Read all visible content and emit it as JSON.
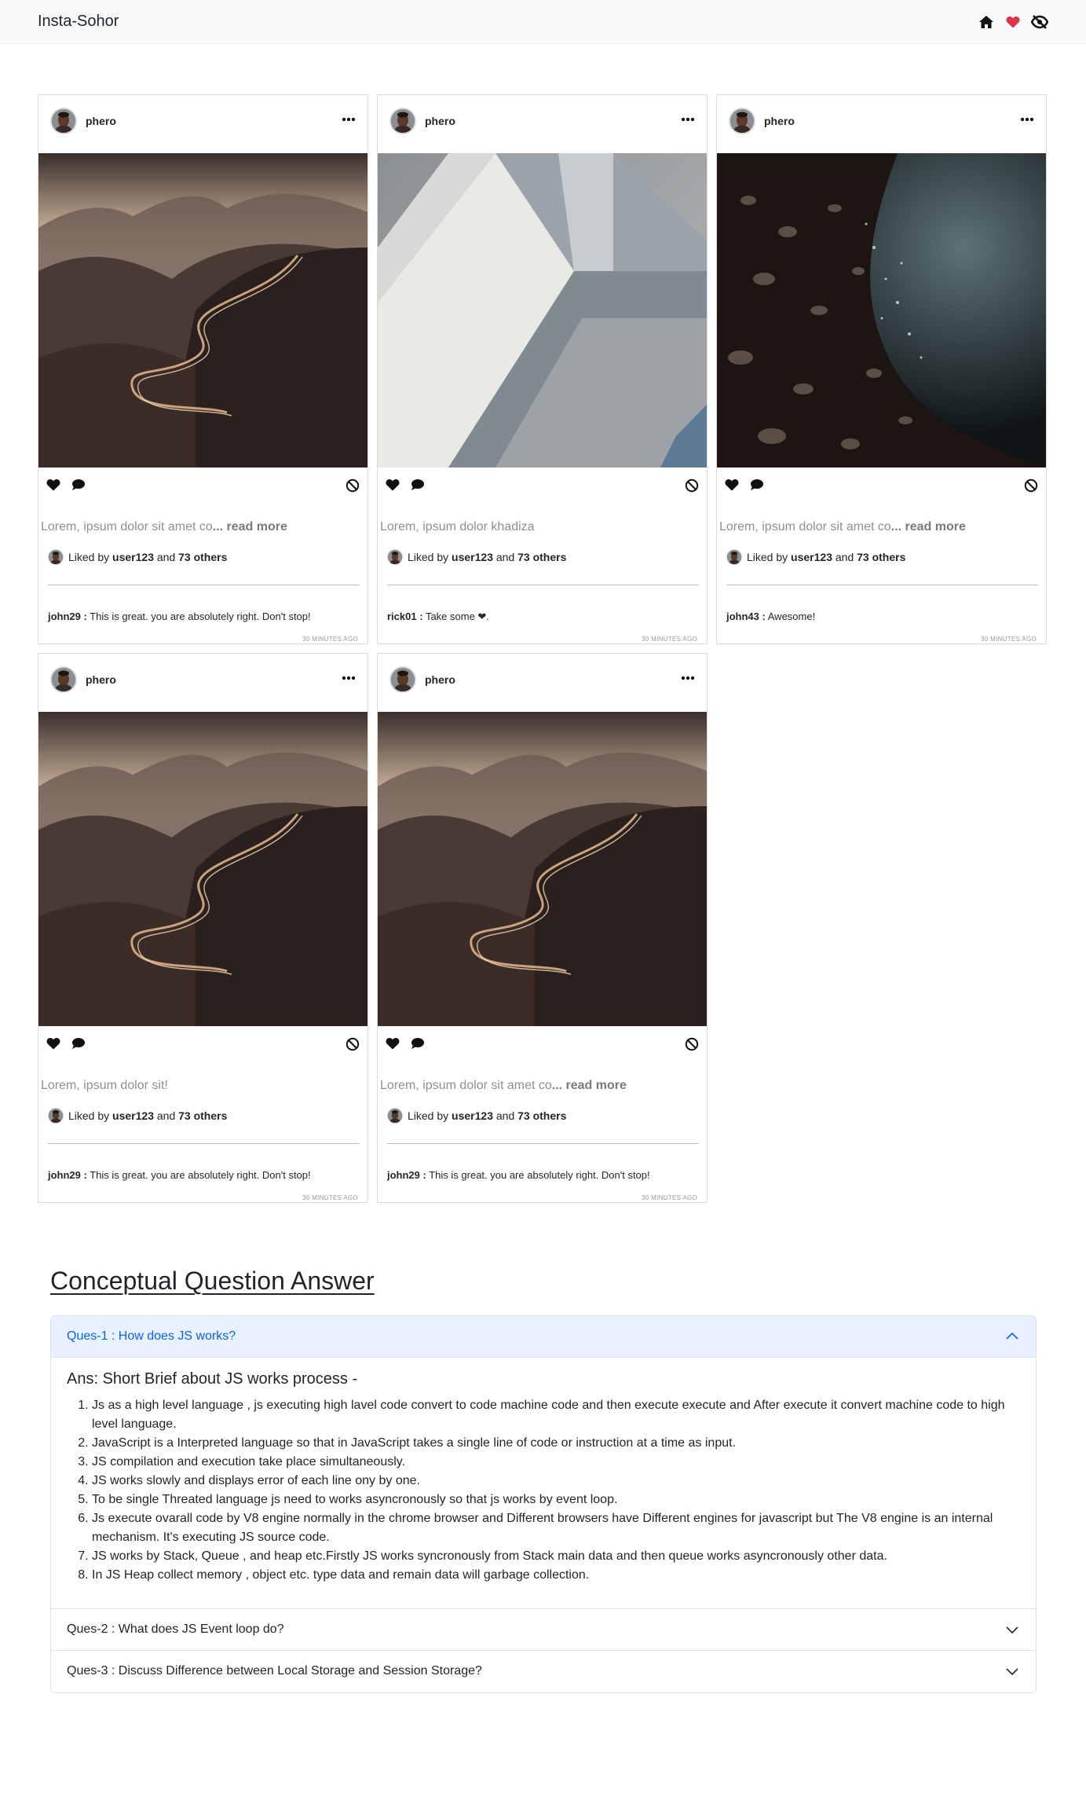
{
  "navbar": {
    "brand": "Insta-Sohor",
    "icons": [
      "home-icon",
      "heart-icon",
      "eye-slash-icon"
    ],
    "heart_color": "#dc3545"
  },
  "posts": [
    {
      "username": "phero",
      "image": "mountain-road",
      "caption": "Lorem, ipsum dolor sit amet co",
      "read_more": "... read more",
      "liked_prefix": "Liked by",
      "liked_user": "user123",
      "liked_and": "and",
      "liked_others": "73 others",
      "comment_user": "john29 :",
      "comment_text": "This is great. you are absolutely right. Don't stop!",
      "time": "30 MINUTES AGO"
    },
    {
      "username": "phero",
      "image": "abstract-geometry",
      "caption": "Lorem, ipsum dolor khadiza",
      "read_more": "",
      "liked_prefix": "Liked by",
      "liked_user": "user123",
      "liked_and": "and",
      "liked_others": "73 others",
      "comment_user": "rick01 :",
      "comment_text": "Take some ❤.",
      "time": "30 MINUTES AGO"
    },
    {
      "username": "phero",
      "image": "pebble-shore",
      "caption": "Lorem, ipsum dolor sit amet co",
      "read_more": "... read more",
      "liked_prefix": "Liked by",
      "liked_user": "user123",
      "liked_and": "and",
      "liked_others": "73 others",
      "comment_user": "john43 :",
      "comment_text": "Awesome!",
      "time": "30 MINUTES AGO"
    },
    {
      "username": "phero",
      "image": "mountain-road",
      "caption": "Lorem, ipsum dolor sit!",
      "read_more": "",
      "liked_prefix": "Liked by",
      "liked_user": "user123",
      "liked_and": "and",
      "liked_others": "73 others",
      "comment_user": "john29 :",
      "comment_text": "This is great. you are absolutely right. Don't stop!",
      "time": "30 MINUTES AGO"
    },
    {
      "username": "phero",
      "image": "mountain-road",
      "caption": "Lorem, ipsum dolor sit amet co",
      "read_more": "... read more",
      "liked_prefix": "Liked by",
      "liked_user": "user123",
      "liked_and": "and",
      "liked_others": "73 others",
      "comment_user": "john29 :",
      "comment_text": "This is great. you are absolutely right. Don't stop!",
      "time": "30 MINUTES AGO"
    }
  ],
  "qa": {
    "title": "Conceptual Question Answer",
    "items": [
      {
        "question": "Ques-1 : How does JS works?",
        "open": true,
        "answer_title": "Ans: Short Brief about JS works process -",
        "answer_points": [
          "Js as a high level language , js executing high lavel code convert to code machine code and then execute execute and After execute it convert machine code to high level language.",
          "JavaScript is a Interpreted language so that in JavaScript takes a single line of code or instruction at a time as input.",
          "JS compilation and execution take place simultaneously.",
          "JS works slowly and displays error of each line ony by one.",
          "To be single Threated language js need to works asyncronously so that js works by event loop.",
          "Js execute ovarall code by V8 engine normally in the chrome browser and Different browsers have Different engines for javascript but The V8 engine is an internal mechanism. It's executing JS source code.",
          "JS works by Stack, Queue , and heap etc.Firstly JS works syncronously from Stack main data and then queue works asyncronously other data.",
          "In JS Heap collect memory , object etc. type data and remain data will garbage collection."
        ]
      },
      {
        "question": "Ques-2 : What does JS Event loop do?",
        "open": false
      },
      {
        "question": "Ques-3 : Discuss Difference between Local Storage and Session Storage?",
        "open": false
      }
    ]
  }
}
